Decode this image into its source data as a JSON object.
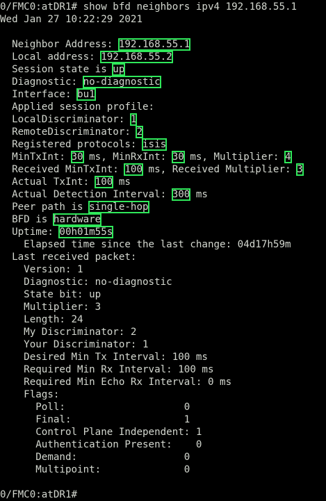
{
  "terminal": {
    "command_line": "0/FMC0:atDR1# show bfd neighbors ipv4 192.168.55.1",
    "timestamp": "Wed Jan 27 10:22:29 2021",
    "neighbor": {
      "neighbor_label": "  Neighbor Address: ",
      "neighbor_value": "192.168.55.1",
      "local_label": "  Local address: ",
      "local_value": "192.168.55.2",
      "state_label": "  Session state is ",
      "state_value": "up",
      "diag_label": "  Diagnostic: ",
      "diag_value": "no-diagnostic",
      "iface_label": "  Interface: ",
      "iface_value": "bu1",
      "profile_label": "  Applied session profile:",
      "ld_label": "  LocalDiscriminator: ",
      "ld_value": "1",
      "rd_label": "  RemoteDiscriminator: ",
      "rd_value": "2",
      "proto_label": "  Registered protocols: ",
      "proto_value": "isis",
      "mintx_label": "  MinTxInt: ",
      "mintx_value": "30",
      "minrx_label": " ms, MinRxInt: ",
      "minrx_value": "30",
      "mult_label": " ms, Multiplier: ",
      "mult_value": "4",
      "rxmintx_label": "  Received MinTxInt: ",
      "rxmintx_value": "100",
      "rxmult_label": " ms, Received Multiplier: ",
      "rxmult_value": "3",
      "acttx_label": "  Actual TxInt: ",
      "acttx_value": "100",
      "acttx_unit": " ms",
      "actdet_label": "  Actual Detection Interval: ",
      "actdet_value": "300",
      "actdet_unit": " ms",
      "peer_label": "  Peer path is ",
      "peer_value": "single-hop",
      "bfd_label": "  BFD is ",
      "bfd_value": "hardware",
      "uptime_label": "  Uptime: ",
      "uptime_value": "00h01m55s",
      "elapsed_line": "    Elapsed time since the last change: 04d17h59m"
    },
    "packet_lines": [
      "  Last received packet:",
      "    Version: 1",
      "    Diagnostic: no-diagnostic",
      "    State bit: up",
      "    Multiplier: 3",
      "    Length: 24",
      "    My Discriminator: 2",
      "    Your Discriminator: 1",
      "    Desired Min Tx Interval: 100 ms",
      "    Required Min Rx Interval: 100 ms",
      "    Required Min Echo Rx Interval: 0 ms",
      "    Flags:",
      "      Poll:                    0",
      "      Final:                   1",
      "      Control Plane Independent: 1",
      "      Authentication Present:    0",
      "      Demand:                  0",
      "      Multipoint:              0"
    ],
    "final_prompt": "0/FMC0:atDR1#"
  },
  "colors": {
    "background": "#000000",
    "text": "#d3d7cf",
    "highlight_box": "#2fe85a"
  }
}
